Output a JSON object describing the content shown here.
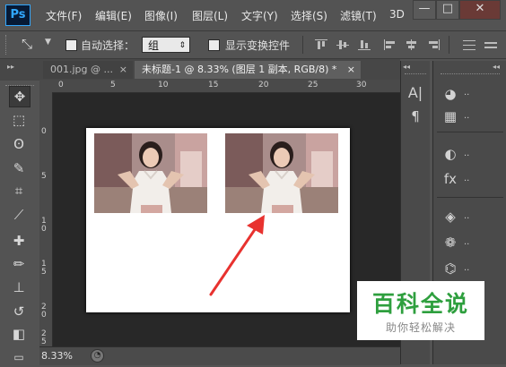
{
  "app": {
    "logo": "Ps"
  },
  "menu": [
    "文件(F)",
    "编辑(E)",
    "图像(I)",
    "图层(L)",
    "文字(Y)",
    "选择(S)",
    "滤镜(T)",
    "3D"
  ],
  "window_controls": {
    "minimize": "—",
    "maximize": "□",
    "close": "✕"
  },
  "options_bar": {
    "auto_select_label": "自动选择：",
    "auto_select_value": "组",
    "show_transform_label": "显示变换控件"
  },
  "tabs": [
    {
      "label": "001.jpg @ ...",
      "close": "×"
    },
    {
      "label": "未标题-1 @ 8.33% (图层 1 副本, RGB/8) *",
      "close": "×"
    }
  ],
  "ruler_top": [
    "0",
    "5",
    "10",
    "15",
    "20",
    "25",
    "30"
  ],
  "ruler_left": [
    [
      "0"
    ],
    [
      "5"
    ],
    [
      "1",
      "0"
    ],
    [
      "1",
      "5"
    ],
    [
      "2",
      "0"
    ],
    [
      "2",
      "5"
    ]
  ],
  "status": {
    "zoom": "8.33%"
  },
  "tool_icons": [
    "move-icon",
    "marquee-icon",
    "lasso-icon",
    "quick-select-icon",
    "crop-icon",
    "eyedropper-icon",
    "healing-brush-icon",
    "brush-icon",
    "clone-stamp-icon",
    "history-brush-icon",
    "eraser-icon"
  ],
  "panel_icons": [
    "character-icon",
    "paragraph-icon",
    "color-icon",
    "swatches-icon",
    "adjustments-icon",
    "styles-icon",
    "layers-icon",
    "channels-icon",
    "paths-icon"
  ],
  "watermark": {
    "title": "百科全说",
    "subtitle": "助你轻松解决"
  },
  "colors": {
    "ui_dark": "#535353",
    "workspace": "#282828",
    "arrow": "#e8322f",
    "watermark_green": "#2e9f3e"
  }
}
